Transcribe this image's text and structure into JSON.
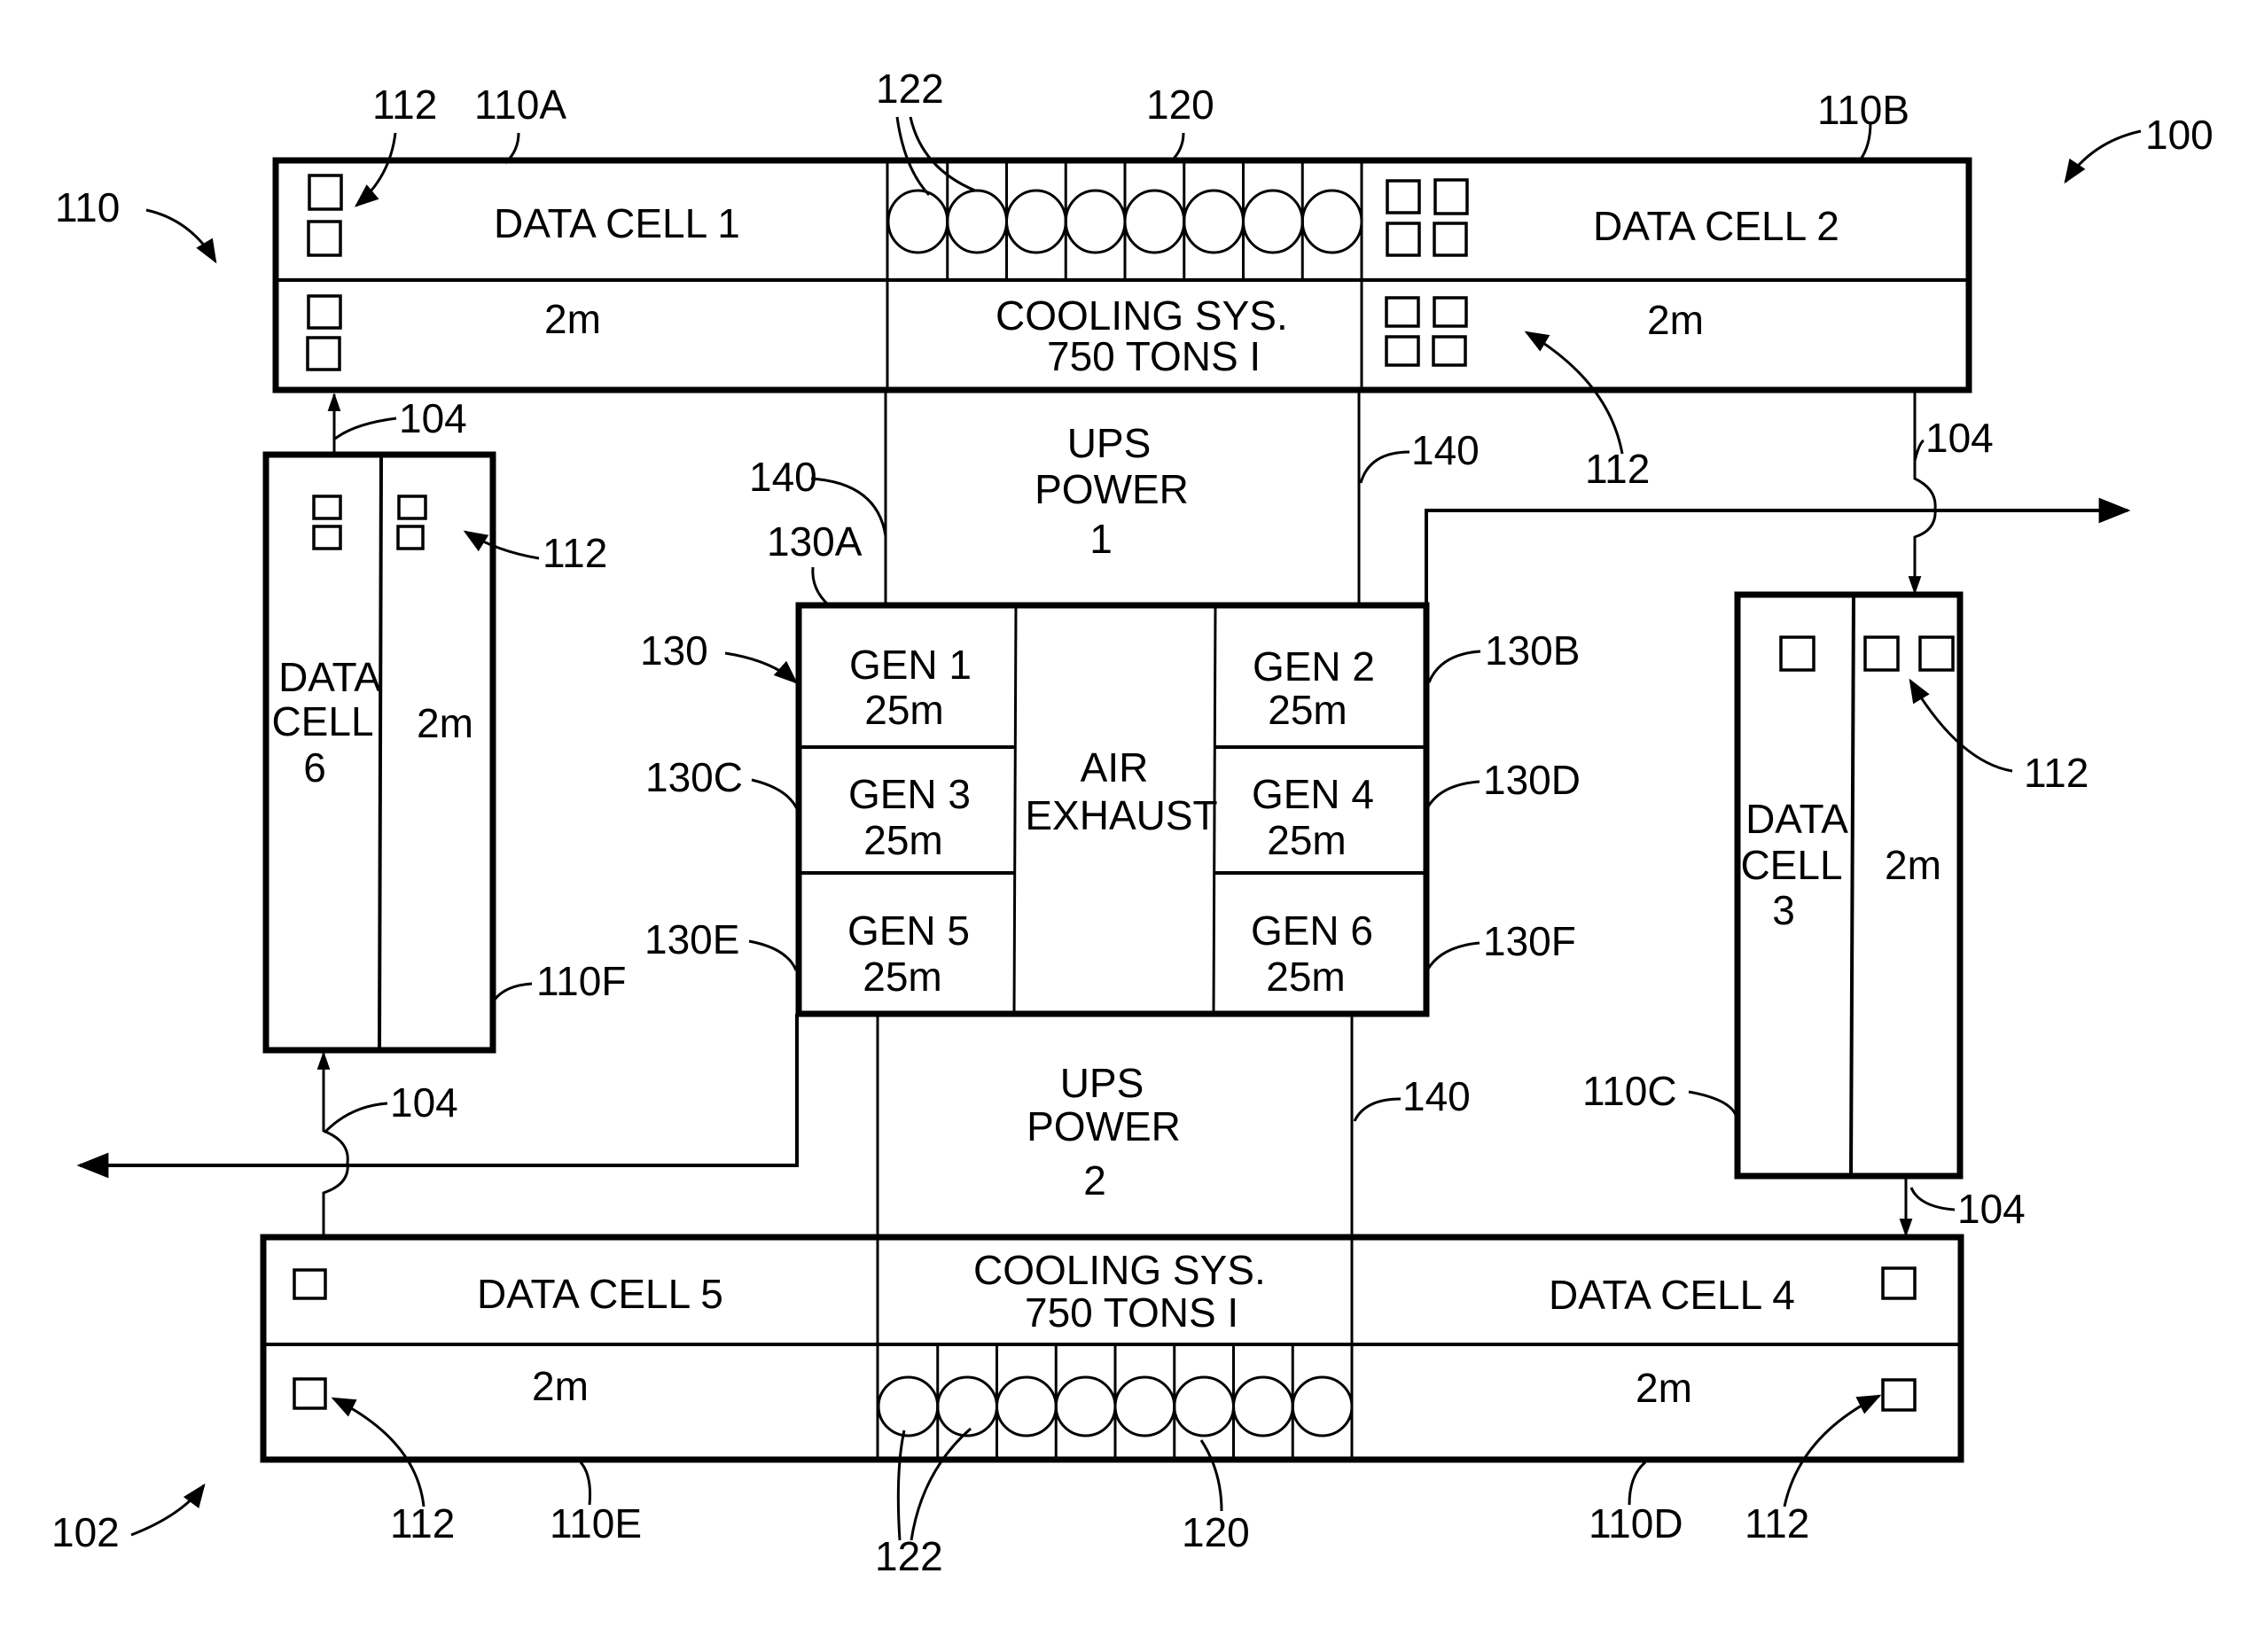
{
  "figure": {
    "system_ref": "100",
    "top_group_ref": "110",
    "bottom_group_ref": "102",
    "data_cells": [
      {
        "id": "110A",
        "name": "DATA CELL 1",
        "capacity": "2m"
      },
      {
        "id": "110B",
        "name": "DATA CELL 2",
        "capacity": "2m"
      },
      {
        "id": "110C",
        "name_lines": [
          "DATA",
          "CELL",
          "3"
        ],
        "capacity": "2m"
      },
      {
        "id": "110D",
        "name": "DATA CELL 4",
        "capacity": "2m"
      },
      {
        "id": "110E",
        "name": "DATA CELL 5",
        "capacity": "2m"
      },
      {
        "id": "110F",
        "name_lines": [
          "DATA",
          "CELL",
          "6"
        ],
        "capacity": "2m"
      }
    ],
    "cooling": [
      {
        "line1": "COOLING SYS.",
        "line2": "750 TONS I",
        "ref": "120",
        "fan_ref": "122",
        "fan_count": 8
      },
      {
        "line1": "COOLING SYS.",
        "line2": "750 TONS I",
        "ref": "120",
        "fan_ref": "122",
        "fan_count": 8
      }
    ],
    "ups": [
      {
        "lines": [
          "UPS",
          "POWER",
          "1"
        ]
      },
      {
        "lines": [
          "UPS",
          "POWER",
          "2"
        ]
      }
    ],
    "generators": {
      "ref": "130",
      "exhaust_lines": [
        "AIR",
        "EXHAUST"
      ],
      "units": [
        {
          "name": "GEN 1",
          "capacity": "25m",
          "ref": "130A"
        },
        {
          "name": "GEN 2",
          "capacity": "25m",
          "ref": "130B"
        },
        {
          "name": "GEN 3",
          "capacity": "25m",
          "ref": "130C"
        },
        {
          "name": "GEN 4",
          "capacity": "25m",
          "ref": "130D"
        },
        {
          "name": "GEN 5",
          "capacity": "25m",
          "ref": "130E"
        },
        {
          "name": "GEN 6",
          "capacity": "25m",
          "ref": "130F"
        }
      ]
    },
    "refs": {
      "server_rack": "112",
      "air_flow": "104",
      "power_line": "140"
    }
  }
}
